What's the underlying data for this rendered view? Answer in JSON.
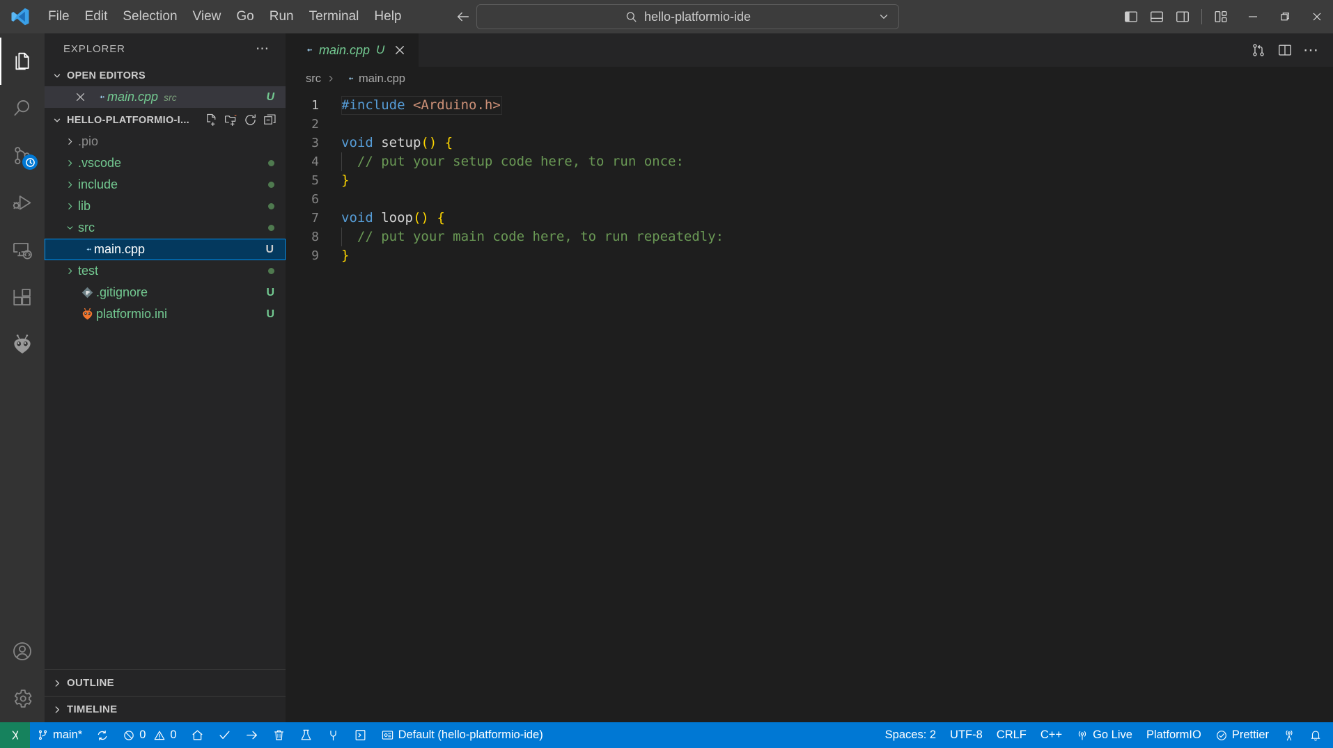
{
  "titlebar": {
    "logo": "vscode-logo",
    "menus": [
      "File",
      "Edit",
      "Selection",
      "View",
      "Go",
      "Run",
      "Terminal",
      "Help"
    ],
    "nav_back": "back-arrow-icon",
    "nav_forward": "forward-arrow-icon",
    "command_center": {
      "search_icon": "search-icon",
      "text": "hello-platformio-ide",
      "chevron": "chevron-down-icon"
    },
    "layout_controls": [
      {
        "name": "toggle-primary-sidebar",
        "icon": "layout-sidebar-left-icon"
      },
      {
        "name": "toggle-panel",
        "icon": "layout-panel-icon"
      },
      {
        "name": "toggle-secondary-sidebar",
        "icon": "layout-sidebar-right-icon"
      },
      {
        "name": "customize-layout",
        "icon": "layout-customize-icon"
      }
    ],
    "window_controls": [
      {
        "name": "minimize-button",
        "glyph": "─"
      },
      {
        "name": "maximize-button",
        "glyph": "❐"
      },
      {
        "name": "close-button",
        "glyph": "✕"
      }
    ]
  },
  "activitybar": {
    "items": [
      {
        "name": "explorer",
        "icon": "files-icon",
        "active": true
      },
      {
        "name": "search",
        "icon": "search-icon",
        "active": false
      },
      {
        "name": "source-control",
        "icon": "source-control-icon",
        "active": false,
        "badge": "clock-badge"
      },
      {
        "name": "run-and-debug",
        "icon": "run-debug-icon",
        "active": false
      },
      {
        "name": "remote-explorer",
        "icon": "remote-explorer-icon",
        "active": false
      },
      {
        "name": "extensions",
        "icon": "extensions-icon",
        "active": false
      },
      {
        "name": "platformio",
        "icon": "platformio-alien-icon",
        "active": false
      }
    ],
    "bottom": [
      {
        "name": "accounts",
        "icon": "account-icon"
      },
      {
        "name": "manage-settings",
        "icon": "gear-icon"
      }
    ]
  },
  "sidebar": {
    "title": "EXPLORER",
    "more_actions": "ellipsis-icon",
    "open_editors": {
      "label": "OPEN EDITORS",
      "expanded": true,
      "items": [
        {
          "close_icon": "close-icon",
          "file_icon": "cpp-icon",
          "name": "main.cpp",
          "description": "src",
          "badge": "U",
          "active": true
        }
      ]
    },
    "folder": {
      "label": "HELLO-PLATFORMIO-I...",
      "expanded": true,
      "actions": [
        {
          "name": "new-file-button",
          "icon": "new-file-icon"
        },
        {
          "name": "new-folder-button",
          "icon": "new-folder-icon"
        },
        {
          "name": "refresh-explorer-button",
          "icon": "refresh-icon"
        },
        {
          "name": "collapse-folders-button",
          "icon": "collapse-all-icon"
        }
      ],
      "tree": [
        {
          "name": ".pio",
          "type": "folder",
          "expanded": false,
          "color": "gray",
          "dot": false,
          "badge": ""
        },
        {
          "name": ".vscode",
          "type": "folder",
          "expanded": false,
          "color": "green",
          "dot": true,
          "badge": ""
        },
        {
          "name": "include",
          "type": "folder",
          "expanded": false,
          "color": "green",
          "dot": true,
          "badge": ""
        },
        {
          "name": "lib",
          "type": "folder",
          "expanded": false,
          "color": "green",
          "dot": true,
          "badge": ""
        },
        {
          "name": "src",
          "type": "folder",
          "expanded": true,
          "color": "green",
          "dot": true,
          "badge": ""
        },
        {
          "name": "main.cpp",
          "type": "file",
          "icon": "cpp-icon",
          "color": "white",
          "dot": false,
          "badge": "U",
          "selected": true,
          "indent": 1
        },
        {
          "name": "test",
          "type": "folder",
          "expanded": false,
          "color": "green",
          "dot": true,
          "badge": ""
        },
        {
          "name": ".gitignore",
          "type": "file",
          "icon": "git-icon",
          "color": "green",
          "dot": false,
          "badge": "U"
        },
        {
          "name": "platformio.ini",
          "type": "file",
          "icon": "platformio-icon",
          "color": "green",
          "dot": false,
          "badge": "U"
        }
      ]
    },
    "outline": {
      "label": "OUTLINE",
      "expanded": false
    },
    "timeline": {
      "label": "TIMELINE",
      "expanded": false
    }
  },
  "editor": {
    "tabs": [
      {
        "icon": "cpp-icon",
        "label": "main.cpp",
        "dirty_badge": "U",
        "close_icon": "close-icon",
        "active": true
      }
    ],
    "actions": [
      {
        "name": "source-control-graph-button",
        "icon": "git-compare-icon"
      },
      {
        "name": "split-editor-button",
        "icon": "split-editor-icon"
      },
      {
        "name": "more-actions-button",
        "icon": "ellipsis-icon"
      }
    ],
    "breadcrumbs": [
      {
        "label": "src",
        "icon": ""
      },
      {
        "label": "main.cpp",
        "icon": "cpp-icon"
      }
    ],
    "line_numbers": [
      "1",
      "2",
      "3",
      "4",
      "5",
      "6",
      "7",
      "8",
      "9"
    ],
    "current_line": 1,
    "code": [
      {
        "n": 1,
        "tokens": [
          {
            "t": "#include",
            "c": "pre"
          },
          {
            "t": " ",
            "c": "id"
          },
          {
            "t": "<Arduino.h>",
            "c": "str"
          }
        ]
      },
      {
        "n": 2,
        "tokens": []
      },
      {
        "n": 3,
        "tokens": [
          {
            "t": "void",
            "c": "kw"
          },
          {
            "t": " ",
            "c": "id"
          },
          {
            "t": "setup",
            "c": "id"
          },
          {
            "t": "()",
            "c": "par"
          },
          {
            "t": " ",
            "c": "id"
          },
          {
            "t": "{",
            "c": "par"
          }
        ]
      },
      {
        "n": 4,
        "tokens": [
          {
            "t": "  ",
            "c": "id"
          },
          {
            "t": "// put your setup code here, to run once:",
            "c": "cmt"
          }
        ]
      },
      {
        "n": 5,
        "tokens": [
          {
            "t": "}",
            "c": "par"
          }
        ]
      },
      {
        "n": 6,
        "tokens": []
      },
      {
        "n": 7,
        "tokens": [
          {
            "t": "void",
            "c": "kw"
          },
          {
            "t": " ",
            "c": "id"
          },
          {
            "t": "loop",
            "c": "id"
          },
          {
            "t": "()",
            "c": "par"
          },
          {
            "t": " ",
            "c": "id"
          },
          {
            "t": "{",
            "c": "par"
          }
        ]
      },
      {
        "n": 8,
        "tokens": [
          {
            "t": "  ",
            "c": "id"
          },
          {
            "t": "// put your main code here, to run repeatedly:",
            "c": "cmt"
          }
        ]
      },
      {
        "n": 9,
        "tokens": [
          {
            "t": "}",
            "c": "par"
          }
        ]
      }
    ]
  },
  "statusbar": {
    "remote": {
      "icon": "remote-indicator-icon",
      "label": ""
    },
    "left": [
      {
        "name": "git-branch",
        "icon": "source-control-icon",
        "label": "main*"
      },
      {
        "name": "git-sync",
        "icon": "sync-icon",
        "label": ""
      },
      {
        "name": "problems",
        "icon": "error-icon",
        "label": "0",
        "icon2": "warning-icon",
        "label2": "0"
      },
      {
        "name": "platformio-home",
        "icon": "home-icon",
        "label": ""
      },
      {
        "name": "platformio-build",
        "icon": "check-icon",
        "label": ""
      },
      {
        "name": "platformio-upload",
        "icon": "arrow-right-icon",
        "label": ""
      },
      {
        "name": "platformio-clean",
        "icon": "trash-icon",
        "label": ""
      },
      {
        "name": "platformio-test",
        "icon": "beaker-icon",
        "label": ""
      },
      {
        "name": "platformio-serial-monitor",
        "icon": "plug-icon",
        "label": ""
      },
      {
        "name": "platformio-new-terminal",
        "icon": "terminal-icon",
        "label": ""
      },
      {
        "name": "platformio-project-env",
        "icon": "circuit-board-icon",
        "label": "Default (hello-platformio-ide)"
      }
    ],
    "right": [
      {
        "name": "editor-indentation",
        "label": "Spaces: 2"
      },
      {
        "name": "editor-encoding",
        "label": "UTF-8"
      },
      {
        "name": "editor-eol",
        "label": "CRLF"
      },
      {
        "name": "editor-language-mode",
        "label": "C++"
      },
      {
        "name": "go-live",
        "icon": "broadcast-icon",
        "label": "Go Live"
      },
      {
        "name": "platformio-status",
        "label": "PlatformIO"
      },
      {
        "name": "prettier",
        "icon": "prettier-check-icon",
        "label": "Prettier"
      },
      {
        "name": "remote-tunnel",
        "icon": "radio-tower-icon",
        "label": ""
      },
      {
        "name": "notifications",
        "icon": "bell-icon",
        "label": ""
      }
    ]
  },
  "colors": {
    "accent": "#0078d4",
    "remote_green": "#16825d",
    "selected_row": "#04395e",
    "selected_border": "#0097fb",
    "modified_green": "#73c991",
    "comment_green": "#6a9955",
    "keyword_blue": "#569cd6",
    "string_salmon": "#ce9178",
    "bracket_gold": "#ffd700"
  }
}
